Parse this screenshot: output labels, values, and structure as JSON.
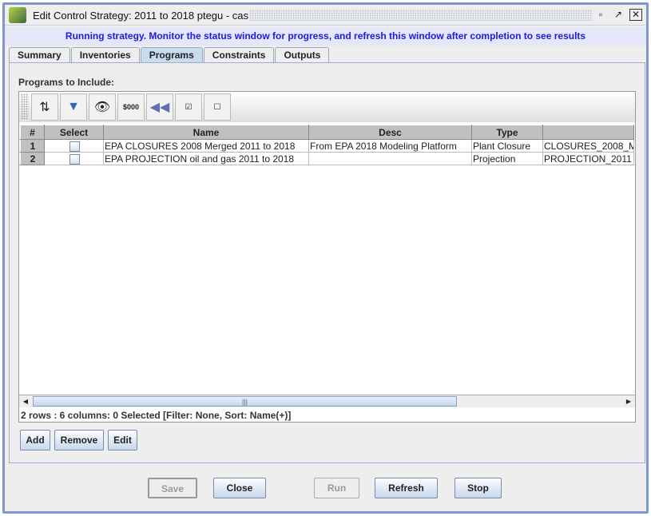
{
  "window": {
    "title": "Edit Control Strategy: 2011 to 2018 ptegu - cas",
    "message": "Running strategy. Monitor the status window for progress, and refresh this window after completion to see results"
  },
  "tabs": [
    {
      "label": "Summary"
    },
    {
      "label": "Inventories"
    },
    {
      "label": "Programs",
      "active": true
    },
    {
      "label": "Constraints"
    },
    {
      "label": "Outputs"
    }
  ],
  "programs": {
    "label": "Programs to Include:",
    "toolbar": [
      "sort-icon",
      "filter-icon",
      "view-icon",
      "format-icon",
      "reset-icon",
      "select-all-icon",
      "clear-selection-icon"
    ],
    "format_label": "$000",
    "columns": [
      "#",
      "Select",
      "Name",
      "Desc",
      "Type",
      ""
    ],
    "rows": [
      {
        "num": "1",
        "selected": false,
        "name": "EPA CLOSURES 2008 Merged 2011 to 2018",
        "desc": "From EPA 2018 Modeling Platform",
        "type": "Plant Closure",
        "extra": "CLOSURES_2008_M"
      },
      {
        "num": "2",
        "selected": false,
        "name": "EPA PROJECTION oil and gas 2011 to 2018",
        "desc": "",
        "type": "Projection",
        "extra": "PROJECTION_2011"
      }
    ],
    "status": "2 rows : 6 columns: 0 Selected [Filter: None, Sort: Name(+)]",
    "buttons": {
      "add": "Add",
      "remove": "Remove",
      "edit": "Edit"
    }
  },
  "footer": {
    "save": "Save",
    "close": "Close",
    "run": "Run",
    "refresh": "Refresh",
    "stop": "Stop"
  },
  "colors": {
    "message": "#1a1ae6",
    "message_bg": "#e6e6fa",
    "border": "#7f97cc"
  }
}
